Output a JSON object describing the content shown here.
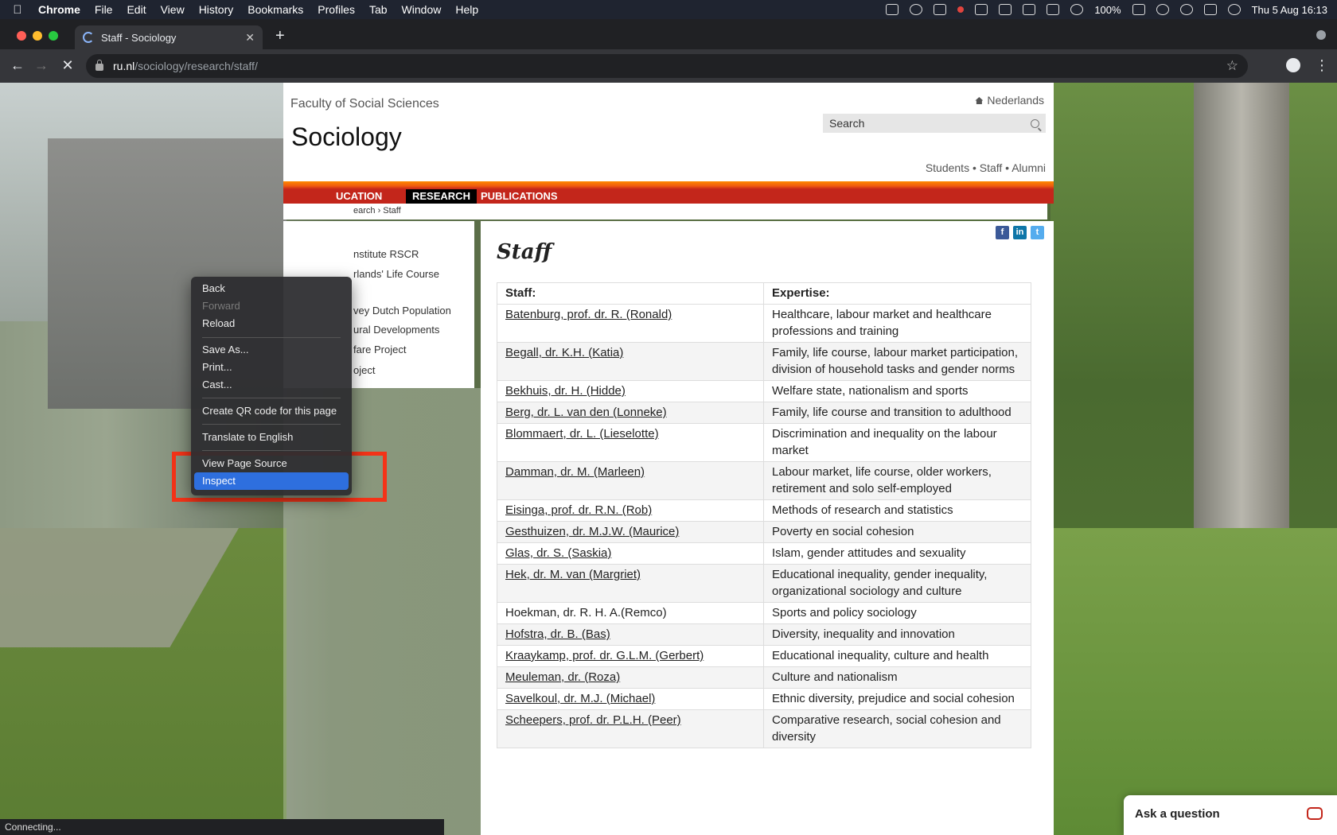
{
  "menubar": {
    "app": "Chrome",
    "items": [
      "File",
      "Edit",
      "View",
      "History",
      "Bookmarks",
      "Profiles",
      "Tab",
      "Window",
      "Help"
    ],
    "battery": "100%",
    "clock": "Thu 5 Aug  16:13"
  },
  "browser": {
    "tab_title": "Staff - Sociology",
    "url_host": "ru.nl",
    "url_path": "/sociology/research/staff/",
    "status_text": "Connecting..."
  },
  "site": {
    "faculty": "Faculty of Social Sciences",
    "title": "Sociology",
    "language_link": "Nederlands",
    "search_placeholder": "Search",
    "audience_links": "Students • Staff • Alumni",
    "nav": [
      "UCATION",
      "RESEARCH",
      "PUBLICATIONS"
    ],
    "breadcrumb": "earch › Staff",
    "sidebar_links": [
      "nstitute RSCR",
      "rlands' Life Course",
      "vey Dutch Population",
      "ural Developments",
      "fare Project",
      "oject"
    ]
  },
  "main": {
    "heading": "Staff",
    "share": [
      "f",
      "in",
      "t"
    ],
    "table": {
      "headers": [
        "Staff:",
        "Expertise:"
      ],
      "rows": [
        {
          "name": "Batenburg, prof. dr. R. (Ronald)",
          "expertise": "Healthcare, labour market and healthcare professions and training",
          "link": true
        },
        {
          "name": "Begall, dr. K.H. (Katia)",
          "expertise": "Family, life course, labour market participation, division of household tasks and gender norms",
          "link": true
        },
        {
          "name": "Bekhuis, dr. H. (Hidde)",
          "expertise": "Welfare state, nationalism and sports",
          "link": true
        },
        {
          "name": "Berg, dr. L. van den (Lonneke)",
          "expertise": "Family, life course and transition to adulthood",
          "link": true
        },
        {
          "name": "Blommaert, dr. L. (Lieselotte)",
          "expertise": "Discrimination and inequality on the labour market",
          "link": true
        },
        {
          "name": "Damman, dr. M. (Marleen)",
          "expertise": "Labour market, life course, older workers, retirement and solo self-employed",
          "link": true
        },
        {
          "name": "Eisinga, prof. dr. R.N. (Rob)",
          "expertise": "Methods of research and statistics",
          "link": true
        },
        {
          "name": "Gesthuizen, dr. M.J.W. (Maurice)",
          "expertise": "Poverty en social cohesion",
          "link": true
        },
        {
          "name": "Glas, dr. S. (Saskia)",
          "expertise": "Islam, gender attitudes and sexuality",
          "link": true
        },
        {
          "name": "Hek, dr. M. van (Margriet)",
          "expertise": "Educational inequality, gender inequality, organizational sociology and culture",
          "link": true
        },
        {
          "name": "Hoekman, dr. R. H. A.(Remco)",
          "expertise": "Sports and policy sociology",
          "link": false
        },
        {
          "name": "Hofstra, dr. B. (Bas)",
          "expertise": "Diversity, inequality and innovation",
          "link": true
        },
        {
          "name": "Kraaykamp, prof. dr. G.L.M. (Gerbert)",
          "expertise": "Educational inequality, culture and health",
          "link": true
        },
        {
          "name": "Meuleman, dr. (Roza)",
          "expertise": "Culture and nationalism",
          "link": true
        },
        {
          "name": "Savelkoul, dr. M.J. (Michael)",
          "expertise": "Ethnic diversity, prejudice and social cohesion",
          "link": true
        },
        {
          "name": "Scheepers, prof. dr. P.L.H. (Peer)",
          "expertise": "Comparative research, social cohesion and diversity",
          "link": true
        }
      ]
    }
  },
  "context_menu": {
    "items": [
      {
        "label": "Back",
        "disabled": false
      },
      {
        "label": "Forward",
        "disabled": true
      },
      {
        "label": "Reload",
        "disabled": false
      },
      {
        "label": "Save As...",
        "disabled": false
      },
      {
        "label": "Print...",
        "disabled": false
      },
      {
        "label": "Cast...",
        "disabled": false
      },
      {
        "label": "Create QR code for this page",
        "disabled": false
      },
      {
        "label": "Translate to English",
        "disabled": false
      },
      {
        "label": "View Page Source",
        "disabled": false
      },
      {
        "label": "Inspect",
        "disabled": false,
        "selected": true
      }
    ],
    "highlight_color": "#f43318"
  },
  "chat": {
    "label": "Ask a question"
  },
  "colors": {
    "nav_red": "#c3261b",
    "nav_orange": "#ff8a00",
    "menu_selected": "#2e6fde"
  }
}
